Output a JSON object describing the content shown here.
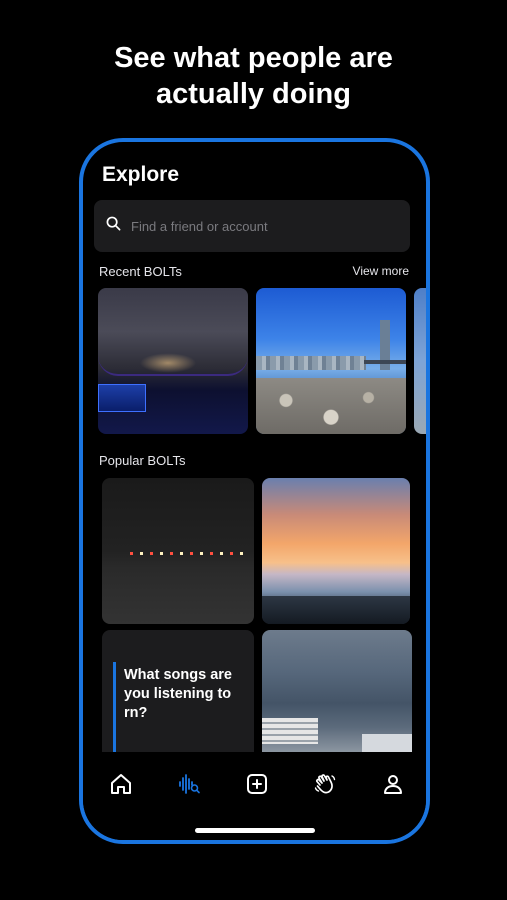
{
  "headline": {
    "line1": "See what people are",
    "line2": "actually doing"
  },
  "screen": {
    "title": "Explore",
    "search": {
      "placeholder": "Find a friend or account",
      "icon": "search-icon"
    },
    "recent": {
      "label": "Recent BOLTs",
      "view_more": "View more"
    },
    "popular": {
      "label": "Popular BOLTs",
      "question_card": "What songs are you listening to rn?"
    }
  },
  "tabbar": {
    "items": [
      "home-icon",
      "explore-waveform-icon",
      "add-post-icon",
      "wave-hand-icon",
      "profile-icon"
    ],
    "active": "explore-waveform-icon",
    "active_color": "#1a75e0"
  },
  "colors": {
    "accent": "#1a75e0",
    "background": "#000000",
    "card": "#1c1c1e"
  }
}
